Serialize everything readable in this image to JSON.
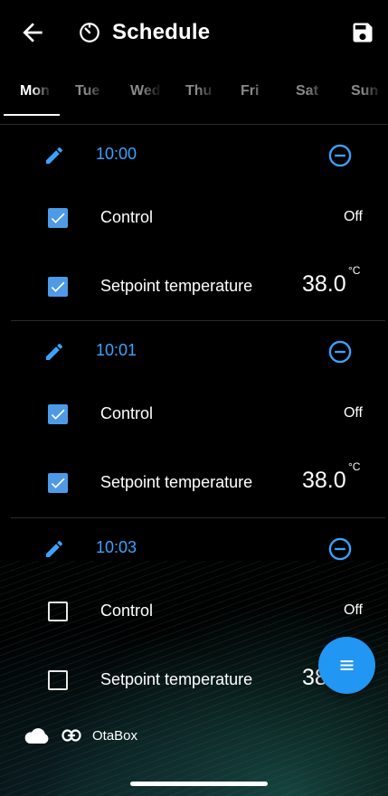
{
  "header": {
    "title": "Schedule",
    "back_icon": "arrow-back-icon",
    "title_icon": "timer-icon",
    "save_icon": "save-icon"
  },
  "tabs": [
    {
      "label": "Mon",
      "active": true
    },
    {
      "label": "Tue",
      "active": false
    },
    {
      "label": "Wed",
      "active": false
    },
    {
      "label": "Thu",
      "active": false
    },
    {
      "label": "Fri",
      "active": false
    },
    {
      "label": "Sat",
      "active": false
    },
    {
      "label": "Sun",
      "active": false
    }
  ],
  "entries": [
    {
      "time": "10:00",
      "control": {
        "label": "Control",
        "checked": true,
        "value": "Off"
      },
      "setpoint": {
        "label": "Setpoint temperature",
        "checked": true,
        "value": "38.0",
        "unit": "°C"
      }
    },
    {
      "time": "10:01",
      "control": {
        "label": "Control",
        "checked": true,
        "value": "Off"
      },
      "setpoint": {
        "label": "Setpoint temperature",
        "checked": true,
        "value": "38.0",
        "unit": "°C"
      }
    },
    {
      "time": "10:03",
      "control": {
        "label": "Control",
        "checked": false,
        "value": "Off"
      },
      "setpoint": {
        "label": "Setpoint temperature",
        "checked": false,
        "value": "38",
        "unit": ""
      }
    }
  ],
  "footer": {
    "device_name": "OtaBox",
    "cloud_icon": "cloud-icon",
    "link_icon": "link-icon"
  },
  "fab": {
    "icon": "menu-icon"
  },
  "colors": {
    "accent": "#3aa3ff",
    "checkbox": "#4e9ae6",
    "fab": "#2196f3",
    "background": "#000000"
  }
}
